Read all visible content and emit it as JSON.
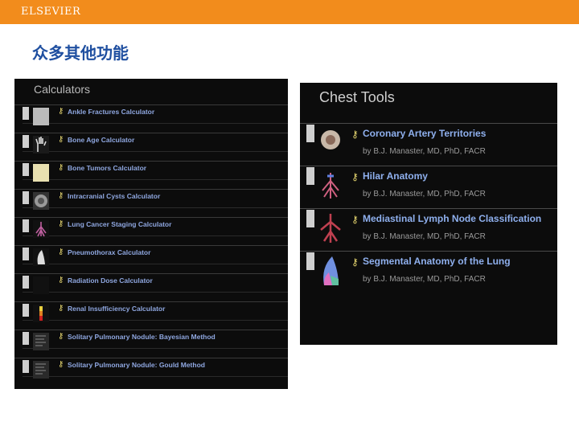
{
  "header": {
    "brand": "ELSEVIER",
    "brand_color": "#f28c1c"
  },
  "page": {
    "title": "众多其他功能"
  },
  "calculators": {
    "title": "Calculators",
    "items": [
      {
        "label": "Ankle Fractures Calculator",
        "icon": "ankle-xray-icon"
      },
      {
        "label": "Bone Age Calculator",
        "icon": "hand-xray-icon"
      },
      {
        "label": "Bone Tumors Calculator",
        "icon": "bone-icon"
      },
      {
        "label": "Intracranial Cysts Calculator",
        "icon": "brain-scan-icon"
      },
      {
        "label": "Lung Cancer Staging Calculator",
        "icon": "lung-icon"
      },
      {
        "label": "Pneumothorax Calculator",
        "icon": "lung-outline-icon"
      },
      {
        "label": "Radiation Dose Calculator",
        "icon": "radiation-icon"
      },
      {
        "label": "Renal Insufficiency Calculator",
        "icon": "gauge-icon"
      },
      {
        "label": "Solitary Pulmonary Nodule: Bayesian Method",
        "icon": "document-icon"
      },
      {
        "label": "Solitary Pulmonary Nodule: Gould Method",
        "icon": "document-icon"
      }
    ]
  },
  "chest_tools": {
    "title": "Chest Tools",
    "items": [
      {
        "label": "Coronary Artery Territories",
        "author": "by B.J. Manaster, MD, PhD, FACR",
        "icon": "heart-icon"
      },
      {
        "label": "Hilar Anatomy",
        "author": "by B.J. Manaster, MD, PhD, FACR",
        "icon": "vessels-icon"
      },
      {
        "label": "Mediastinal Lymph Node Classification",
        "author": "by B.J. Manaster, MD, PhD, FACR",
        "icon": "lymph-node-icon"
      },
      {
        "label": "Segmental Anatomy of the Lung",
        "author": "by B.J. Manaster, MD, PhD, FACR",
        "icon": "lung-segments-icon"
      }
    ]
  }
}
